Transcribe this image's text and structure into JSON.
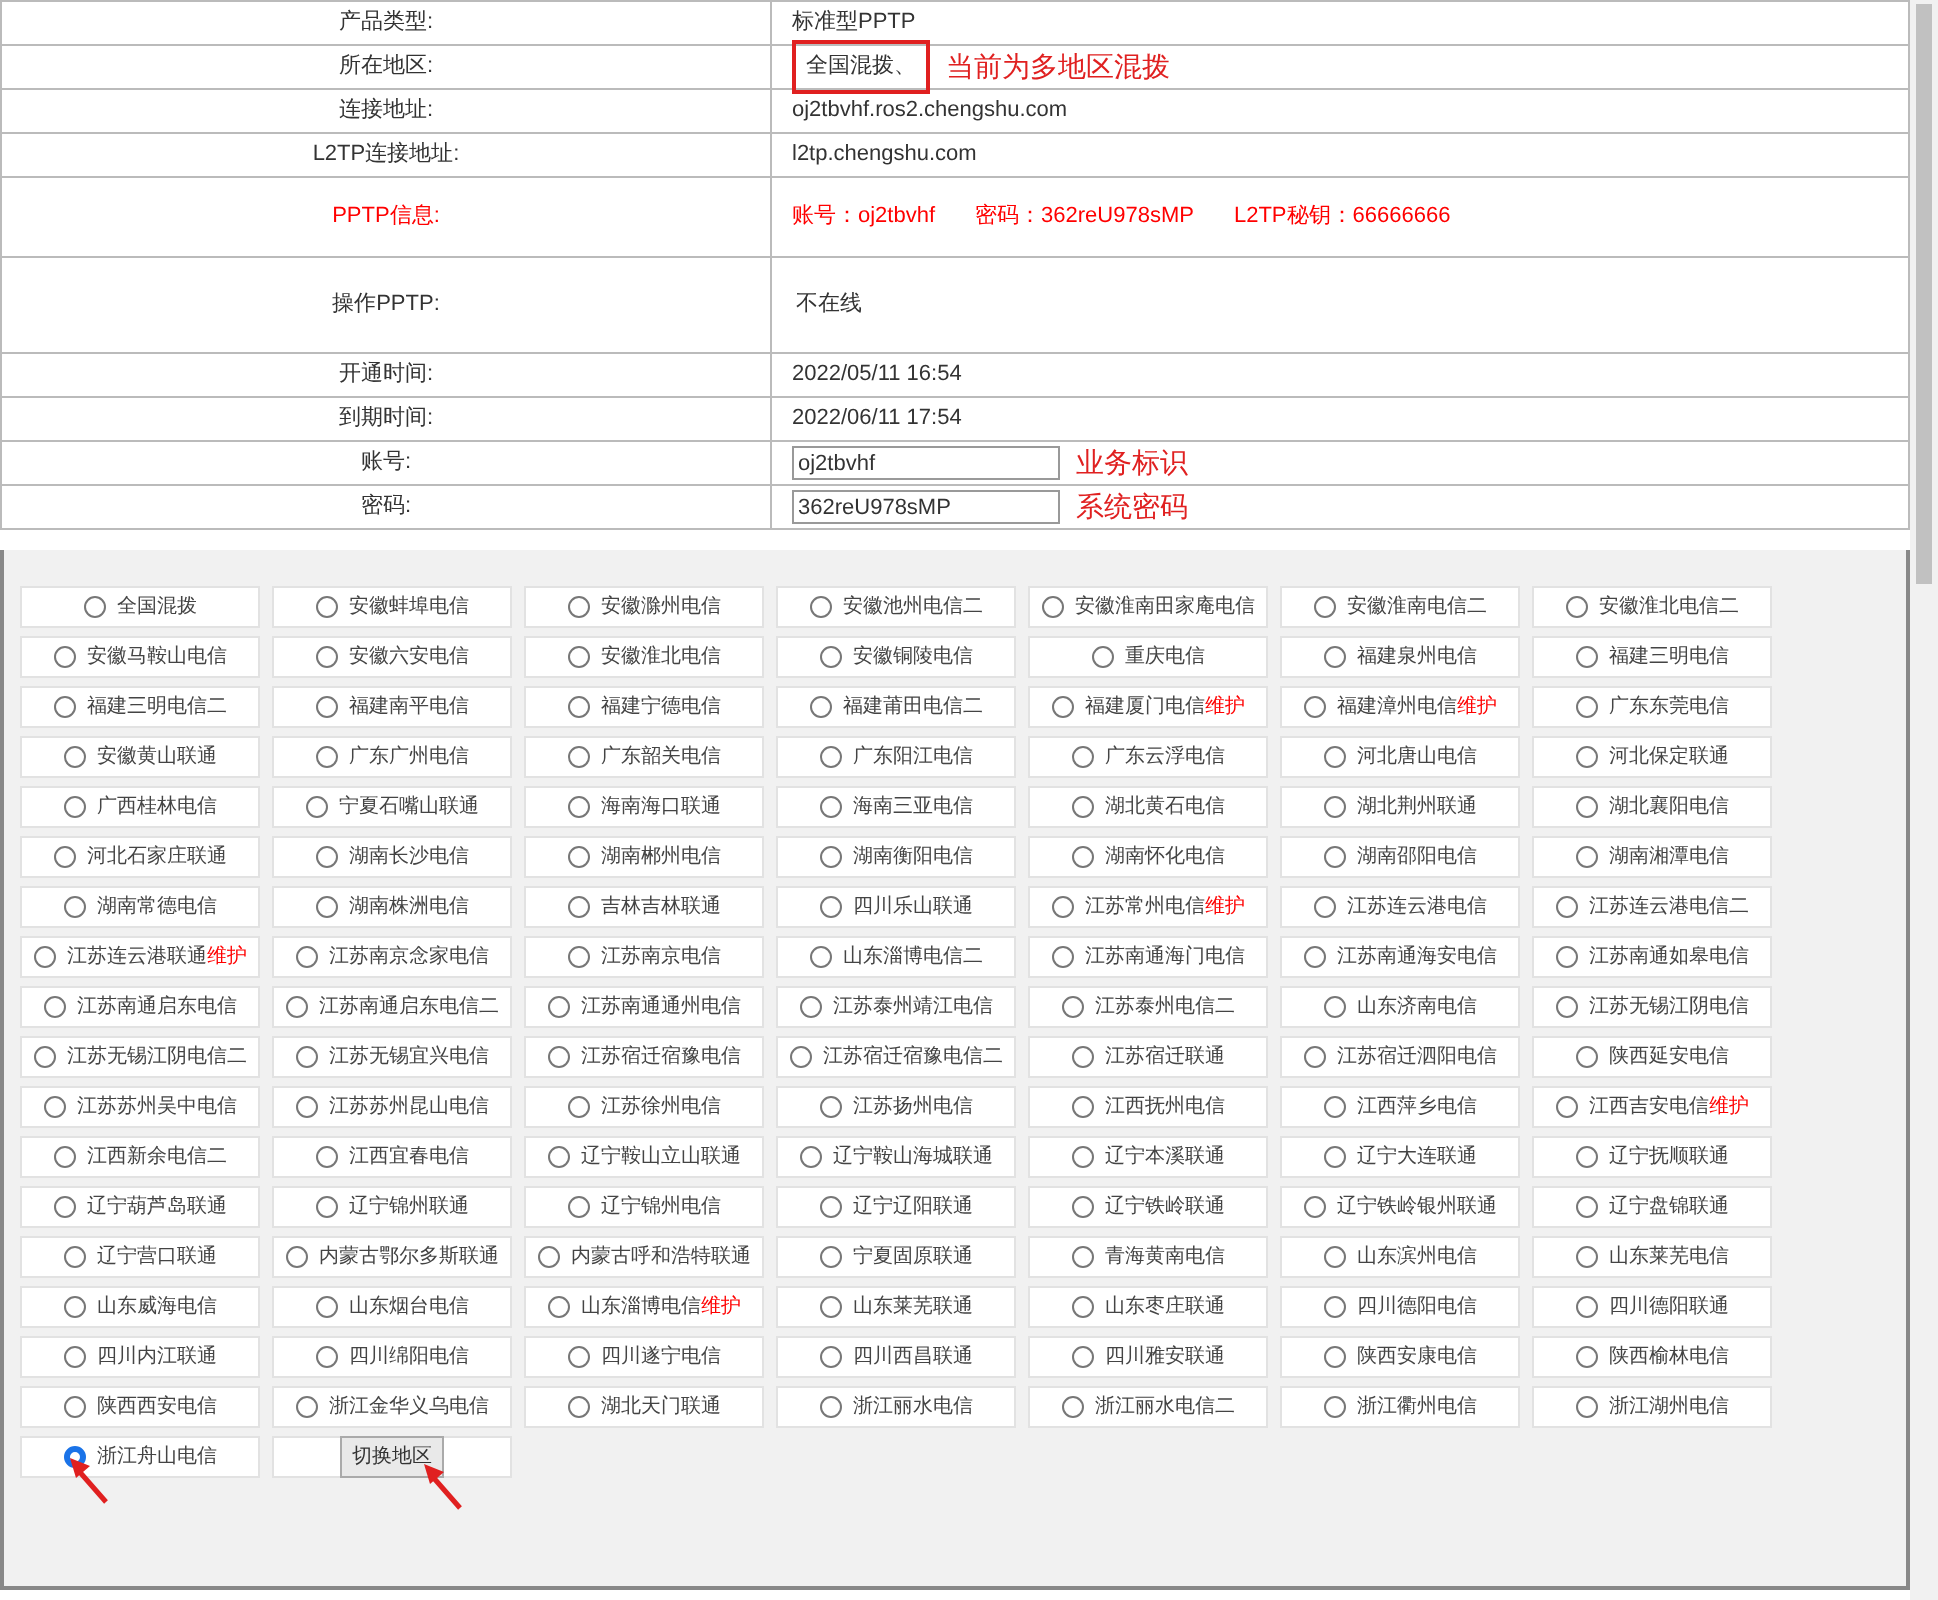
{
  "info_rows": [
    {
      "label": "产品类型:",
      "value": "标准型PPTP"
    },
    {
      "label": "所在地区:",
      "value": "全国混拨、",
      "boxed": true,
      "note": "当前为多地区混拨"
    },
    {
      "label": "连接地址:",
      "value": "oj2tbvhf.ros2.chengshu.com"
    },
    {
      "label": "L2TP连接地址:",
      "value": "l2tp.chengshu.com"
    },
    {
      "label": "PPTP信息:",
      "kind": "credentials",
      "parts": [
        "账号：oj2tbvhf",
        "密码：362reU978sMP",
        "L2TP秘钥：66666666"
      ]
    },
    {
      "label": "操作PPTP:",
      "kind": "tall",
      "value": "不在线"
    },
    {
      "label": "开通时间:",
      "value": "2022/05/11 16:54"
    },
    {
      "label": "到期时间:",
      "value": "2022/06/11 17:54"
    },
    {
      "label": "账号:",
      "kind": "input",
      "value": "oj2tbvhf",
      "note": "业务标识"
    },
    {
      "label": "密码:",
      "kind": "input",
      "value": "362reU978sMP",
      "note": "系统密码"
    }
  ],
  "regions": [
    {
      "name": "全国混拨",
      "selected": false
    },
    {
      "name": "安徽蚌埠电信",
      "selected": false
    },
    {
      "name": "安徽滁州电信",
      "selected": false
    },
    {
      "name": "安徽池州电信二",
      "selected": false
    },
    {
      "name": "安徽淮南田家庵电信",
      "selected": false
    },
    {
      "name": "安徽淮南电信二",
      "selected": false
    },
    {
      "name": "安徽淮北电信二",
      "selected": false
    },
    {
      "name": "安徽马鞍山电信",
      "selected": false
    },
    {
      "name": "安徽六安电信",
      "selected": false
    },
    {
      "name": "安徽淮北电信",
      "selected": false
    },
    {
      "name": "安徽铜陵电信",
      "selected": false
    },
    {
      "name": "重庆电信",
      "selected": false
    },
    {
      "name": "福建泉州电信",
      "selected": false
    },
    {
      "name": "福建三明电信",
      "selected": false
    },
    {
      "name": "福建三明电信二",
      "selected": false
    },
    {
      "name": "福建南平电信",
      "selected": false
    },
    {
      "name": "福建宁德电信",
      "selected": false
    },
    {
      "name": "福建莆田电信二",
      "selected": false
    },
    {
      "name": "福建厦门电信",
      "status": "维护",
      "selected": false
    },
    {
      "name": "福建漳州电信",
      "status": "维护",
      "selected": false
    },
    {
      "name": "广东东莞电信",
      "selected": false
    },
    {
      "name": "安徽黄山联通",
      "selected": false
    },
    {
      "name": "广东广州电信",
      "selected": false
    },
    {
      "name": "广东韶关电信",
      "selected": false
    },
    {
      "name": "广东阳江电信",
      "selected": false
    },
    {
      "name": "广东云浮电信",
      "selected": false
    },
    {
      "name": "河北唐山电信",
      "selected": false
    },
    {
      "name": "河北保定联通",
      "selected": false
    },
    {
      "name": "广西桂林电信",
      "selected": false
    },
    {
      "name": "宁夏石嘴山联通",
      "selected": false
    },
    {
      "name": "海南海口联通",
      "selected": false
    },
    {
      "name": "海南三亚电信",
      "selected": false
    },
    {
      "name": "湖北黄石电信",
      "selected": false
    },
    {
      "name": "湖北荆州联通",
      "selected": false
    },
    {
      "name": "湖北襄阳电信",
      "selected": false
    },
    {
      "name": "河北石家庄联通",
      "selected": false
    },
    {
      "name": "湖南长沙电信",
      "selected": false
    },
    {
      "name": "湖南郴州电信",
      "selected": false
    },
    {
      "name": "湖南衡阳电信",
      "selected": false
    },
    {
      "name": "湖南怀化电信",
      "selected": false
    },
    {
      "name": "湖南邵阳电信",
      "selected": false
    },
    {
      "name": "湖南湘潭电信",
      "selected": false
    },
    {
      "name": "湖南常德电信",
      "selected": false
    },
    {
      "name": "湖南株洲电信",
      "selected": false
    },
    {
      "name": "吉林吉林联通",
      "selected": false
    },
    {
      "name": "四川乐山联通",
      "selected": false
    },
    {
      "name": "江苏常州电信",
      "status": "维护",
      "selected": false
    },
    {
      "name": "江苏连云港电信",
      "selected": false
    },
    {
      "name": "江苏连云港电信二",
      "selected": false
    },
    {
      "name": "江苏连云港联通",
      "status": "维护",
      "selected": false
    },
    {
      "name": "江苏南京念家电信",
      "selected": false
    },
    {
      "name": "江苏南京电信",
      "selected": false
    },
    {
      "name": "山东淄博电信二",
      "selected": false
    },
    {
      "name": "江苏南通海门电信",
      "selected": false
    },
    {
      "name": "江苏南通海安电信",
      "selected": false
    },
    {
      "name": "江苏南通如皋电信",
      "selected": false
    },
    {
      "name": "江苏南通启东电信",
      "selected": false
    },
    {
      "name": "江苏南通启东电信二",
      "selected": false
    },
    {
      "name": "江苏南通通州电信",
      "selected": false
    },
    {
      "name": "江苏泰州靖江电信",
      "selected": false
    },
    {
      "name": "江苏泰州电信二",
      "selected": false
    },
    {
      "name": "山东济南电信",
      "selected": false
    },
    {
      "name": "江苏无锡江阴电信",
      "selected": false
    },
    {
      "name": "江苏无锡江阴电信二",
      "selected": false
    },
    {
      "name": "江苏无锡宜兴电信",
      "selected": false
    },
    {
      "name": "江苏宿迁宿豫电信",
      "selected": false
    },
    {
      "name": "江苏宿迁宿豫电信二",
      "selected": false
    },
    {
      "name": "江苏宿迁联通",
      "selected": false
    },
    {
      "name": "江苏宿迁泗阳电信",
      "selected": false
    },
    {
      "name": "陕西延安电信",
      "selected": false
    },
    {
      "name": "江苏苏州吴中电信",
      "selected": false
    },
    {
      "name": "江苏苏州昆山电信",
      "selected": false
    },
    {
      "name": "江苏徐州电信",
      "selected": false
    },
    {
      "name": "江苏扬州电信",
      "selected": false
    },
    {
      "name": "江西抚州电信",
      "selected": false
    },
    {
      "name": "江西萍乡电信",
      "selected": false
    },
    {
      "name": "江西吉安电信",
      "status": "维护",
      "selected": false
    },
    {
      "name": "江西新余电信二",
      "selected": false
    },
    {
      "name": "江西宜春电信",
      "selected": false
    },
    {
      "name": "辽宁鞍山立山联通",
      "selected": false
    },
    {
      "name": "辽宁鞍山海城联通",
      "selected": false
    },
    {
      "name": "辽宁本溪联通",
      "selected": false
    },
    {
      "name": "辽宁大连联通",
      "selected": false
    },
    {
      "name": "辽宁抚顺联通",
      "selected": false
    },
    {
      "name": "辽宁葫芦岛联通",
      "selected": false
    },
    {
      "name": "辽宁锦州联通",
      "selected": false
    },
    {
      "name": "辽宁锦州电信",
      "selected": false
    },
    {
      "name": "辽宁辽阳联通",
      "selected": false
    },
    {
      "name": "辽宁铁岭联通",
      "selected": false
    },
    {
      "name": "辽宁铁岭银州联通",
      "selected": false
    },
    {
      "name": "辽宁盘锦联通",
      "selected": false
    },
    {
      "name": "辽宁营口联通",
      "selected": false
    },
    {
      "name": "内蒙古鄂尔多斯联通",
      "selected": false
    },
    {
      "name": "内蒙古呼和浩特联通",
      "selected": false
    },
    {
      "name": "宁夏固原联通",
      "selected": false
    },
    {
      "name": "青海黄南电信",
      "selected": false
    },
    {
      "name": "山东滨州电信",
      "selected": false
    },
    {
      "name": "山东莱芜电信",
      "selected": false
    },
    {
      "name": "山东威海电信",
      "selected": false
    },
    {
      "name": "山东烟台电信",
      "selected": false
    },
    {
      "name": "山东淄博电信",
      "status": "维护",
      "selected": false
    },
    {
      "name": "山东莱芜联通",
      "selected": false
    },
    {
      "name": "山东枣庄联通",
      "selected": false
    },
    {
      "name": "四川德阳电信",
      "selected": false
    },
    {
      "name": "四川德阳联通",
      "selected": false
    },
    {
      "name": "四川内江联通",
      "selected": false
    },
    {
      "name": "四川绵阳电信",
      "selected": false
    },
    {
      "name": "四川遂宁电信",
      "selected": false
    },
    {
      "name": "四川西昌联通",
      "selected": false
    },
    {
      "name": "四川雅安联通",
      "selected": false
    },
    {
      "name": "陕西安康电信",
      "selected": false
    },
    {
      "name": "陕西榆林电信",
      "selected": false
    },
    {
      "name": "陕西西安电信",
      "selected": false
    },
    {
      "name": "浙江金华义乌电信",
      "selected": false
    },
    {
      "name": "湖北天门联通",
      "selected": false
    },
    {
      "name": "浙江丽水电信",
      "selected": false
    },
    {
      "name": "浙江丽水电信二",
      "selected": false
    },
    {
      "name": "浙江衢州电信",
      "selected": false
    },
    {
      "name": "浙江湖州电信",
      "selected": false
    },
    {
      "name": "浙江舟山电信",
      "selected": true
    }
  ],
  "switch_button": "切换地区"
}
